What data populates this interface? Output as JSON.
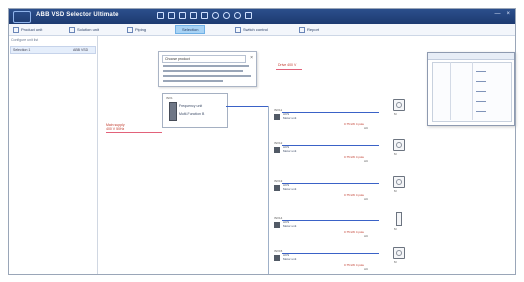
{
  "window": {
    "title": "ABB VSD Selector Ultimate",
    "controls": [
      "—",
      "×"
    ]
  },
  "toolbar": {
    "items": [
      {
        "label": "Product unit"
      },
      {
        "label": "Solution unit"
      },
      {
        "label": "Piping"
      },
      {
        "label": "Selection",
        "active": true
      },
      {
        "label": "Switch control"
      },
      {
        "label": "Report"
      }
    ]
  },
  "sidebar": {
    "heading": "Configure unit list",
    "row": {
      "col1": "Selection 1",
      "col2": "ABB VSD"
    }
  },
  "note": {
    "input_value": "Choose product",
    "close": "×"
  },
  "canvas": {
    "top_red_label": "Drive 400 V",
    "device": {
      "tag": "INV1",
      "label1": "Frequency unit",
      "label2": "Multi-Function B"
    },
    "left_tag": [
      "Main supply",
      "400 V 50Hz"
    ],
    "rows": [
      {
        "tag": "INV11",
        "line1": "ACS",
        "line2": "Motor unit",
        "red": "0.75 kW 4 pole",
        "note": "AC",
        "device": "motor"
      },
      {
        "tag": "INV12",
        "line1": "ACS",
        "line2": "Motor unit",
        "red": "0.75 kW 4 pole",
        "note": "AC",
        "device": "motor"
      },
      {
        "tag": "INV13",
        "line1": "ACS",
        "line2": "Motor unit",
        "red": "0.75 kW 4 pole",
        "note": "AC",
        "device": "motor"
      },
      {
        "tag": "INV14",
        "line1": "ACS",
        "line2": "Motor unit",
        "red": "0.75 kW 4 pole",
        "note": "AC",
        "device": "sensor"
      },
      {
        "tag": "INV15",
        "line1": "ACS",
        "line2": "Motor unit",
        "red": "0.75 kW 4 pole",
        "note": "AC",
        "device": "motor"
      }
    ],
    "motor_caption": "M"
  }
}
